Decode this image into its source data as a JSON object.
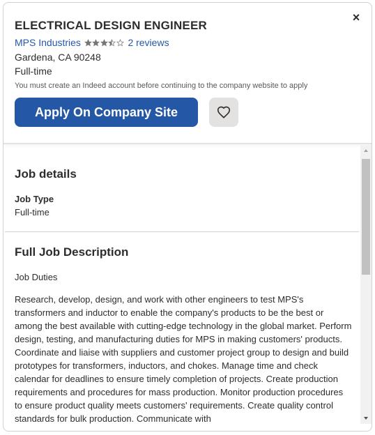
{
  "header": {
    "close_label": "×",
    "job_title": "ELECTRICAL DESIGN ENGINEER",
    "company_name": "MPS Industries",
    "rating": 3.5,
    "rating_max": 5,
    "reviews_label": "2 reviews",
    "location": "Gardena, CA 90248",
    "job_type": "Full-time",
    "notice": "You must create an Indeed account before continuing to the company website to apply",
    "apply_label": "Apply On Company Site",
    "save_icon": "heart-icon"
  },
  "job_details": {
    "title": "Job details",
    "job_type_label": "Job Type",
    "job_type_value": "Full-time"
  },
  "full_description": {
    "title": "Full Job Description",
    "duties_heading": "Job Duties",
    "body": "Research, develop, design, and work with other engineers to test MPS's transformers and inductor to enable the company's products to be the best or among the best available with cutting-edge technology in the global market. Perform design, testing, and manufacturing duties for MPS in making customers' products. Coordinate and liaise with suppliers and customer project group to design and build prototypes for transformers, inductors, and chokes. Manage time and check calendar for deadlines to ensure timely completion of projects. Create production requirements and procedures for mass production. Monitor production procedures to ensure product quality meets customers' requirements. Create quality control standards for bulk production. Communicate with"
  },
  "colors": {
    "accent": "#2557a7",
    "text": "#2d2d2d",
    "star": "#767676",
    "save_bg": "#e4e2e0"
  }
}
